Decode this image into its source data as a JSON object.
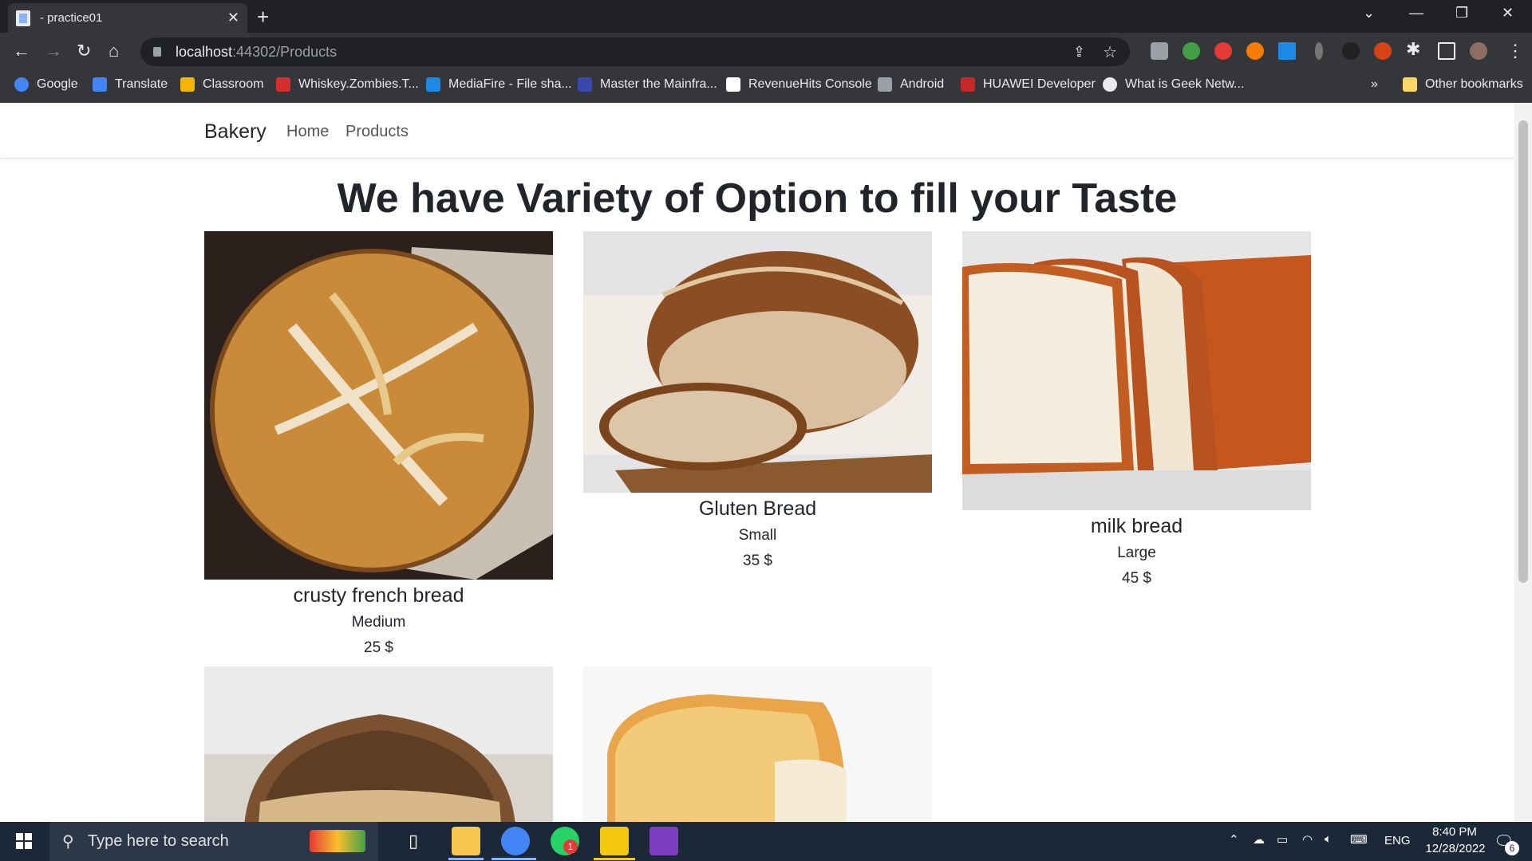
{
  "browser": {
    "tab_title": "- practice01",
    "tab_close": "✕",
    "new_tab": "+",
    "url_host": "localhost",
    "url_path": ":44302/Products",
    "bookmarks": [
      {
        "label": "Google",
        "color": "#4285f4"
      },
      {
        "label": "Translate",
        "color": "#4285f4"
      },
      {
        "label": "Classroom",
        "color": "#f4b400"
      },
      {
        "label": "Whiskey.Zombies.T...",
        "color": "#d32f2f"
      },
      {
        "label": "MediaFire - File sha...",
        "color": "#1e88e5"
      },
      {
        "label": "Master the Mainfra...",
        "color": "#3949ab"
      },
      {
        "label": "RevenueHits Console",
        "color": "#ffffff"
      },
      {
        "label": "Android",
        "color": "#9aa0a6"
      },
      {
        "label": "HUAWEI Developer",
        "color": "#c62828"
      },
      {
        "label": "What is Geek Netw...",
        "color": "#e8eaed"
      }
    ],
    "overflow": "»",
    "other_bookmarks": "Other bookmarks"
  },
  "site": {
    "brand": "Bakery",
    "nav": [
      "Home",
      "Products"
    ],
    "heading": "We have Variety of Option to fill your Taste"
  },
  "products": [
    {
      "name": "crusty french bread",
      "size": "Medium",
      "price": "25 $"
    },
    {
      "name": "Gluten Bread",
      "size": "Small",
      "price": "35 $"
    },
    {
      "name": "milk bread",
      "size": "Large",
      "price": "45 $"
    }
  ],
  "taskbar": {
    "search_placeholder": "Type here to search",
    "language": "ENG",
    "time": "8:40 PM",
    "date": "12/28/2022",
    "whatsapp_badge": "1",
    "notification_count": "6"
  }
}
